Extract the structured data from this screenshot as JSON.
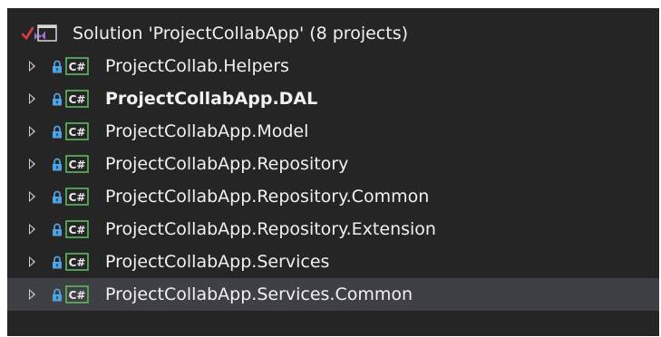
{
  "solution": {
    "label": "Solution 'ProjectCollabApp' (8 projects)"
  },
  "projects": [
    {
      "label": "ProjectCollab.Helpers",
      "bold": false,
      "selected": false
    },
    {
      "label": "ProjectCollabApp.DAL",
      "bold": true,
      "selected": false
    },
    {
      "label": "ProjectCollabApp.Model",
      "bold": false,
      "selected": false
    },
    {
      "label": "ProjectCollabApp.Repository",
      "bold": false,
      "selected": false
    },
    {
      "label": "ProjectCollabApp.Repository.Common",
      "bold": false,
      "selected": false
    },
    {
      "label": "ProjectCollabApp.Repository.Extension",
      "bold": false,
      "selected": false
    },
    {
      "label": "ProjectCollabApp.Services",
      "bold": false,
      "selected": false
    },
    {
      "label": "ProjectCollabApp.Services.Common",
      "bold": false,
      "selected": true
    }
  ],
  "icons": {
    "project": "csharp-project-icon",
    "lock": "lock-icon",
    "expander": "expand-arrow-icon",
    "solution": "solution-icon"
  },
  "colors": {
    "background": "#252526",
    "selected_row": "#3f3f46",
    "text": "#f1f1f1",
    "csharp_green": "#5fb85f",
    "lock_blue": "#4ea3e0",
    "check_red": "#e03c3c",
    "solution_purple": "#a070d0"
  }
}
